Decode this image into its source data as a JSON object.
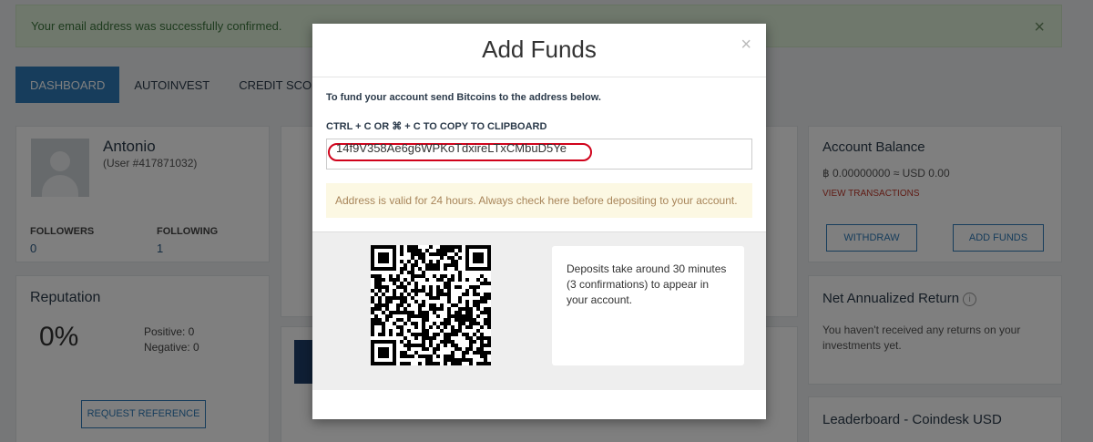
{
  "alert": {
    "message": "Your email address was successfully confirmed.",
    "close": "×"
  },
  "nav": {
    "tabs": [
      "DASHBOARD",
      "AUTOINVEST",
      "CREDIT SCORE"
    ]
  },
  "profile": {
    "name": "Antonio",
    "user_id": "(User #417871032)",
    "followers_label": "FOLLOWERS",
    "followers": "0",
    "following_label": "FOLLOWING",
    "following": "1"
  },
  "reputation": {
    "title": "Reputation",
    "percent": "0%",
    "positive": "Positive: 0",
    "negative": "Negative: 0",
    "button": "REQUEST REFERENCE"
  },
  "balance": {
    "title": "Account Balance",
    "value": "฿ 0.00000000 ≈ USD 0.00",
    "link": "VIEW TRANSACTIONS",
    "withdraw": "WITHDRAW",
    "add_funds": "ADD FUNDS"
  },
  "returns": {
    "title": "Net Annualized Return",
    "info_icon": "i",
    "text": "You haven't received any returns on your investments yet."
  },
  "leaderboard": {
    "title": "Leaderboard - Coindesk USD"
  },
  "modal": {
    "title": "Add Funds",
    "close": "×",
    "instruction": "To fund your account send Bitcoins to the address below.",
    "copy_label": "CTRL + C OR ⌘ + C TO COPY TO CLIPBOARD",
    "address": "14f9V358Ae6g6WPKoTdxireLTxCMbuD5Ye",
    "warning": "Address is valid for 24 hours. Always check here before depositing to your account.",
    "deposit_info": "Deposits take around 30 minutes (3 confirmations) to appear in your account."
  }
}
